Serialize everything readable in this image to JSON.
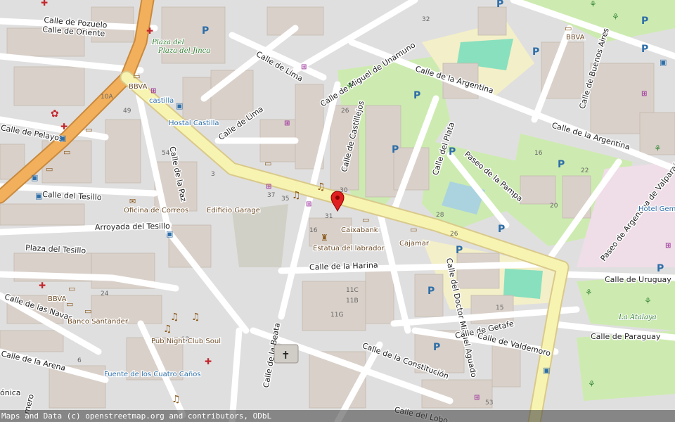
{
  "map": {
    "streets": [
      "Calle de Pozuelo",
      "Calle de Oriente",
      "Calle de Pelayos",
      "Calle del Tesillo",
      "Plaza del Tesillo",
      "Arroyada del Tesillo",
      "Calle de las Navas",
      "Calle de la Arena",
      "Calle de la Paz",
      "Calle de Lima",
      "Calle de Miguel de Unamuno",
      "Calle de Castillejos",
      "Calle de la Argentina",
      "Calle de Buenos Aires",
      "Calle del Plata",
      "Paseo de la Pampa",
      "Paseo de Argentina de Valparaíso",
      "Calle de la Harina",
      "Calle del Doctor Miguel Aguado",
      "Calle de Uruguay",
      "Calle de Paraguay",
      "Calle de Getafe",
      "Calle de Valdemoro",
      "Calle de la Constitución",
      "Calle de la Beata",
      "Calle del Lobo",
      "ónica",
      "mero"
    ],
    "pois": {
      "plaza_del_jinca": "Plaza del Jinca",
      "bbva_1": "BBVA",
      "castilla": "castilla",
      "hostal": "Hostal Castilla",
      "oficina": "Oficina de Correos",
      "edificio": "Edificio Garage",
      "caixabank": "Caixabank",
      "cajamar": "Cajamar",
      "estatua": "Estatua del labrador",
      "bbva_2": "BBVA",
      "bbva_3": "BBVA",
      "banco": "Banco Santander",
      "pub": "Pub Night Club Soul",
      "fuente": "Fuente de los Cuatro Caños",
      "hotel": "Hotel Gem Fuenlabrada",
      "atalaya": "La Atalaya"
    },
    "icons": [
      "parking-icon",
      "bank-icon",
      "pharmacy-icon",
      "bus-stop-icon",
      "music-venue-icon",
      "playground-icon",
      "church-icon",
      "post-office-icon",
      "monument-icon",
      "shop-icon",
      "marker-pin-icon"
    ],
    "colors": {
      "main_road": "#f7f4b2",
      "road_casing": "#d9c98a",
      "primary": "#f2b05c",
      "park": "#cdebb0",
      "building": "#d9d0c9",
      "water": "#aad3df",
      "pitch": "#88e0be"
    }
  },
  "attribution": "Maps and Data (c) openstreetmap.org and contributors, ODbL"
}
